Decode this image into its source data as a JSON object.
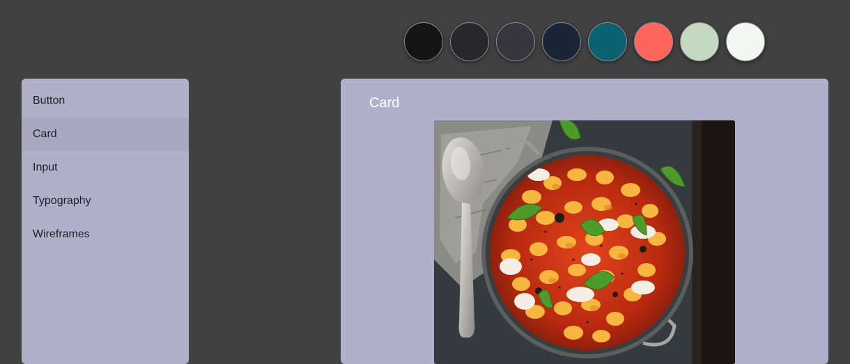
{
  "palette": {
    "swatches": [
      {
        "name": "black",
        "color": "#141414"
      },
      {
        "name": "charcoal",
        "color": "#28282b"
      },
      {
        "name": "graphite",
        "color": "#36363c"
      },
      {
        "name": "navy",
        "color": "#1a2638"
      },
      {
        "name": "teal",
        "color": "#0a6170"
      },
      {
        "name": "coral",
        "color": "#ff655b"
      },
      {
        "name": "sage",
        "color": "#c5d9c2"
      },
      {
        "name": "mint-white",
        "color": "#f2f7f2"
      }
    ]
  },
  "sidebar": {
    "items": [
      {
        "label": "Button",
        "active": false
      },
      {
        "label": "Card",
        "active": true
      },
      {
        "label": "Input",
        "active": false
      },
      {
        "label": "Typography",
        "active": false
      },
      {
        "label": "Wireframes",
        "active": false
      }
    ]
  },
  "main": {
    "title": "Card",
    "image": {
      "subject": "baked-gnocchi-dish-image"
    }
  }
}
